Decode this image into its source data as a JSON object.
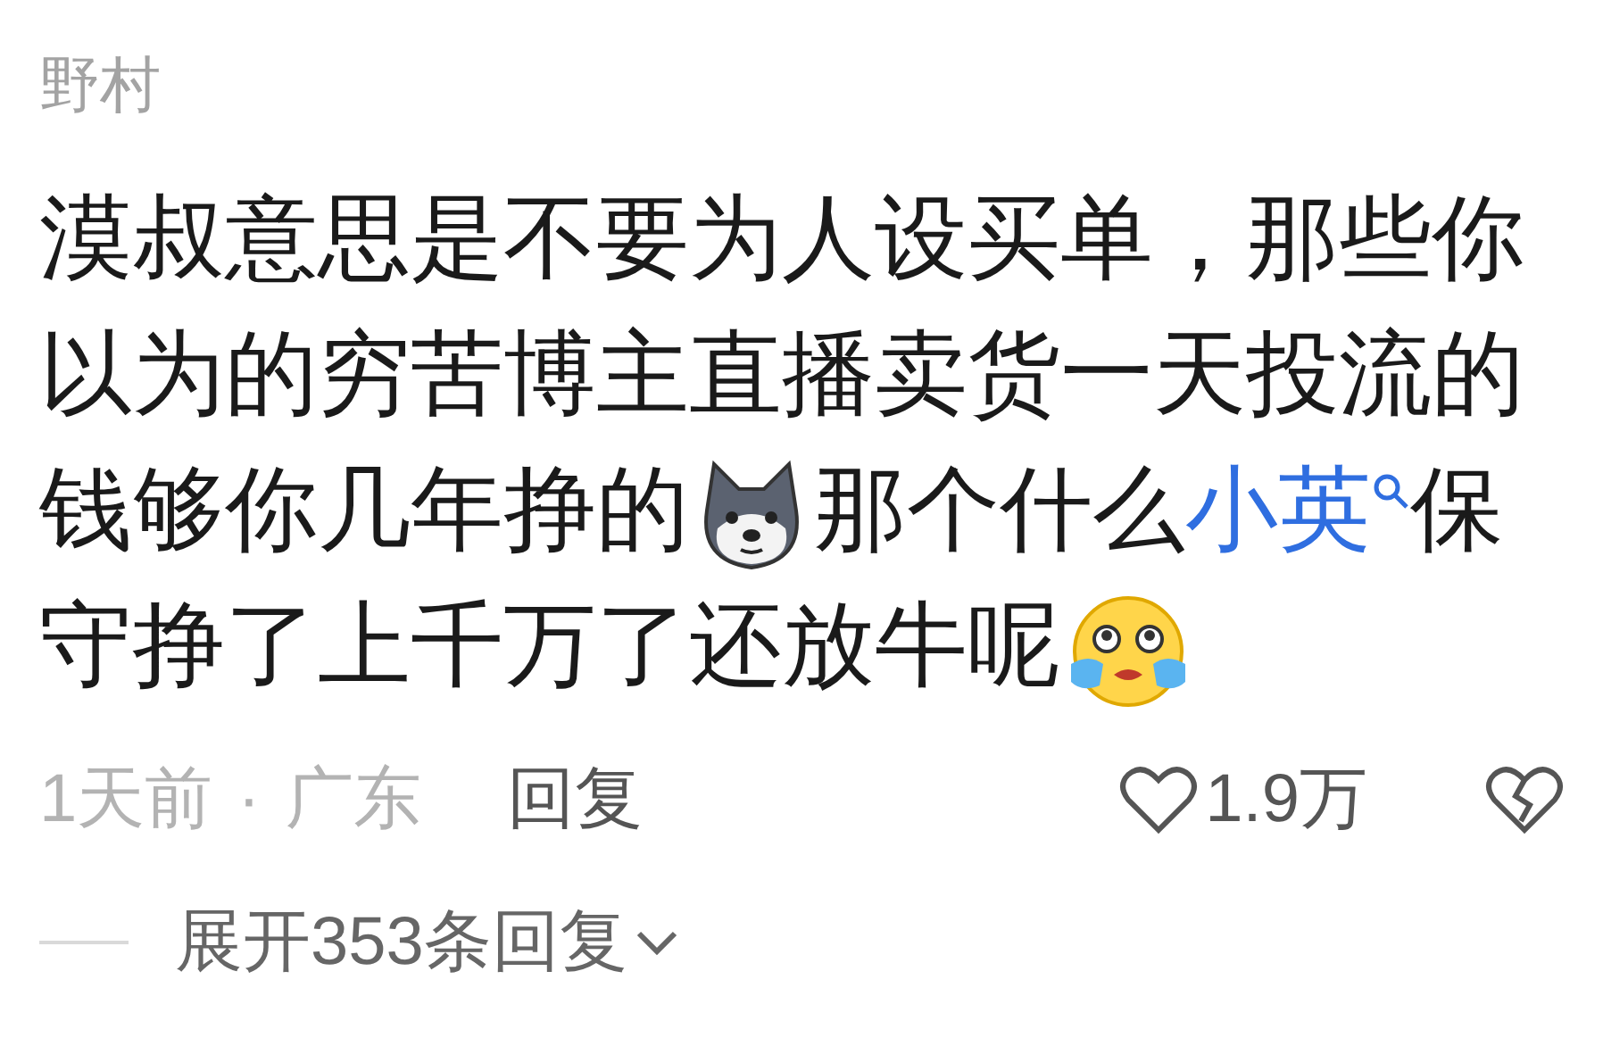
{
  "comment": {
    "author": "野村",
    "segments": [
      {
        "kind": "text",
        "text": "漠叔意思是不要为人设买单，那些你以为的穷苦博主直播卖货一天投流的钱够你几年挣的"
      },
      {
        "kind": "sticker"
      },
      {
        "kind": "text",
        "text": "那个什么"
      },
      {
        "kind": "link",
        "text": "小英"
      },
      {
        "kind": "text",
        "text": "保守挣了上千万了还放牛呢"
      },
      {
        "kind": "sticker"
      }
    ],
    "time": "1天前",
    "separator": "·",
    "location": "广东",
    "reply": "回复",
    "likes": "1.9万",
    "liked": false
  },
  "expand": {
    "label": "展开353条回复"
  }
}
